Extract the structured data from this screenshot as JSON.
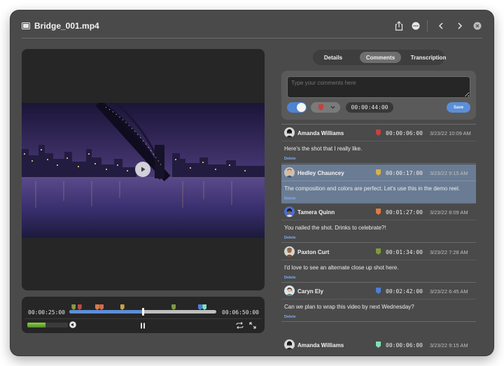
{
  "window": {
    "title": "Bridge_001.mp4"
  },
  "player": {
    "current_time": "00:00:25:00",
    "duration": "00:06:50:00",
    "progress": 0.5,
    "volume": 0.45,
    "marker_colors": [
      "#8a9a3c",
      "#c04a45",
      "#d97a4a",
      "#d96a4a",
      "#cda043",
      "#7f9a3e",
      "#4b7fd6",
      "#7de3c8"
    ]
  },
  "tabs": [
    {
      "label": "Details",
      "active": false
    },
    {
      "label": "Comments",
      "active": true
    },
    {
      "label": "Transcription",
      "active": false
    }
  ],
  "composer": {
    "placeholder": "Type your comments here",
    "timecode": "00:00:44:00",
    "save_label": "Save",
    "marker_color": "#c04a45"
  },
  "comments": [
    {
      "author": "Amanda Williams",
      "timecode": "00:00:06:00",
      "date": "3/23/22 10:09 AM",
      "text": "Here's the shot that I really like.",
      "delete_label": "Delete",
      "flag_color": "#c0433f",
      "selected": false
    },
    {
      "author": "Hedley Chauncey",
      "timecode": "00:00:17:00",
      "date": "3/23/22 9:15 AM",
      "text": "The composition and colors are perfect. Let's use this in the demo reel.",
      "delete_label": "Delete",
      "flag_color": "#d7b04a",
      "selected": true
    },
    {
      "author": "Tamera Quinn",
      "timecode": "00:01:27:00",
      "date": "3/23/22 8:09 AM",
      "text": "You nailed the shot. Drinks to celebrate?!",
      "delete_label": "Delete",
      "flag_color": "#e07a45",
      "selected": false
    },
    {
      "author": "Paxton Curt",
      "timecode": "00:01:34:00",
      "date": "3/23/22 7:28 AM",
      "text": "I'd love to see an alternate close up shot here.",
      "delete_label": "Delete",
      "flag_color": "#7f9a3e",
      "selected": false
    },
    {
      "author": "Caryn Ely",
      "timecode": "00:02:42:00",
      "date": "3/23/22 6:45 AM",
      "text": "Can we plan to wrap this video by next Wednesday?",
      "delete_label": "Delete",
      "flag_color": "#4b7fd6",
      "selected": false
    },
    {
      "author": "Amanda Williams",
      "timecode": "00:00:06:00",
      "date": "3/23/22 9:15 AM",
      "text": "",
      "delete_label": "",
      "flag_color": "#7de3b8",
      "selected": false
    }
  ]
}
